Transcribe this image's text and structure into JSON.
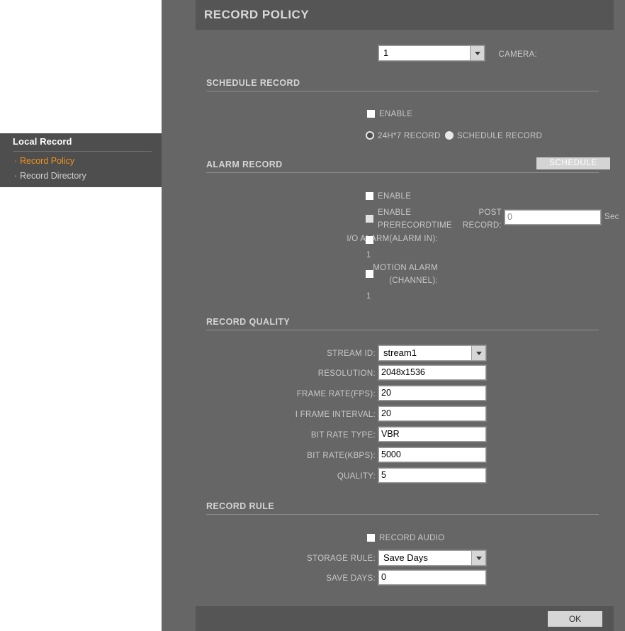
{
  "sidebar": {
    "title": "Local Record",
    "bullet": "·",
    "items": [
      {
        "label": "Record Policy",
        "active": true
      },
      {
        "label": "Record Directory",
        "active": false
      }
    ]
  },
  "panel": {
    "title": "RECORD POLICY"
  },
  "camera": {
    "label": "CAMERA:",
    "value": "1"
  },
  "schedule_record": {
    "section_title": "SCHEDULE RECORD",
    "enable_label": "ENABLE",
    "enable_checked": false,
    "radio_24h_label": "24H*7 RECORD",
    "radio_schedule_label": "SCHEDULE RECORD",
    "radio_selected": "24H*7 RECORD",
    "schedule_button_label": "SCHEDULE"
  },
  "alarm_record": {
    "section_title": "ALARM RECORD",
    "enable_label": "ENABLE",
    "enable_checked": false,
    "prerecord_label_line1": "ENABLE",
    "prerecord_label_line2": "PRERECORDTIME",
    "prerecord_checked": false,
    "post_record_label_line1": "POST",
    "post_record_label_line2": "RECORD:",
    "post_record_value": "0",
    "post_record_unit": "Sec",
    "io_alarm_label": "I/O ALARM(ALARM IN):",
    "io_alarm_checked": false,
    "io_alarm_channel": "1",
    "motion_alarm_label_line1": "MOTION ALARM",
    "motion_alarm_label_line2": "(CHANNEL):",
    "motion_alarm_checked": false,
    "motion_alarm_channel": "1"
  },
  "record_quality": {
    "section_title": "RECORD QUALITY",
    "stream_id_label": "STREAM ID:",
    "stream_id_value": "stream1",
    "resolution_label": "RESOLUTION:",
    "resolution_value": "2048x1536",
    "frame_rate_label": "FRAME RATE(FPS):",
    "frame_rate_value": "20",
    "i_frame_label": "I FRAME INTERVAL:",
    "i_frame_value": "20",
    "bit_rate_type_label": "BIT RATE TYPE:",
    "bit_rate_type_value": "VBR",
    "bit_rate_label": "BIT RATE(KBPS):",
    "bit_rate_value": "5000",
    "quality_label": "QUALITY:",
    "quality_value": "5"
  },
  "record_rule": {
    "section_title": "RECORD RULE",
    "record_audio_label": "RECORD AUDIO",
    "record_audio_checked": false,
    "storage_rule_label": "STORAGE RULE:",
    "storage_rule_value": "Save Days",
    "save_days_label": "SAVE DAYS:",
    "save_days_value": "0"
  },
  "footer": {
    "ok_label": "OK"
  }
}
